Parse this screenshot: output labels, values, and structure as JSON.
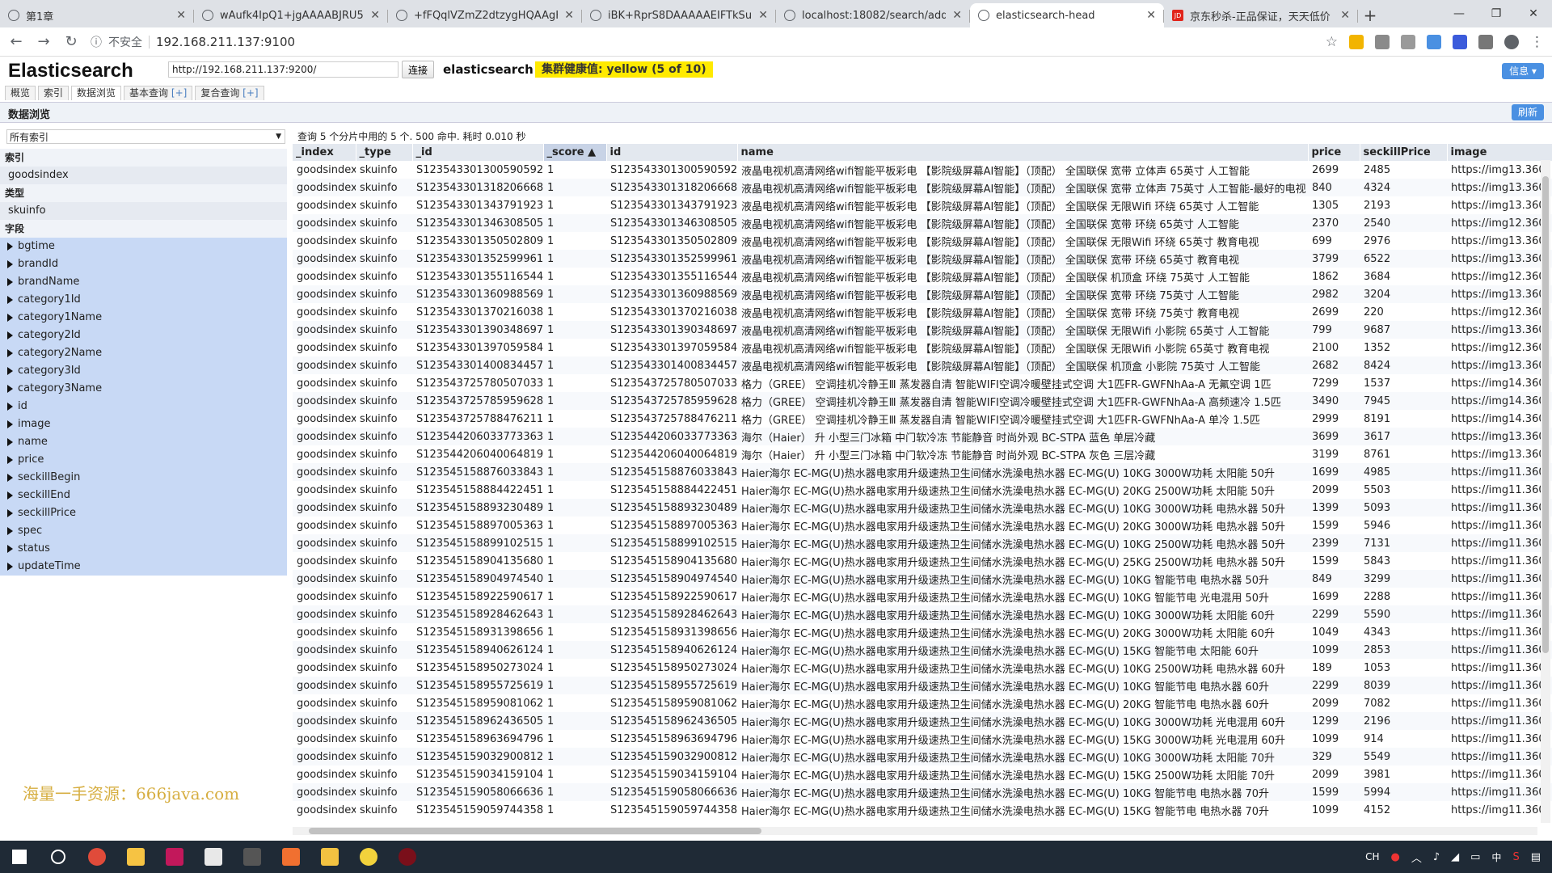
{
  "browser": {
    "tabs": [
      {
        "title": "第1章",
        "active": false
      },
      {
        "title": "wAufk4IpQ1+jgAAAABJRU5E",
        "active": false
      },
      {
        "title": "+fFQqlVZmZ2dtzygHQAAgH",
        "active": false
      },
      {
        "title": "iBK+RprS8DAAAAAEIFTkSuQm",
        "active": false
      },
      {
        "title": "localhost:18082/search/add/a",
        "active": false
      },
      {
        "title": "elasticsearch-head",
        "active": true
      },
      {
        "title": "京东秒杀-正品保证，天天低价",
        "active": false
      }
    ],
    "address_insecure": "不安全",
    "address_url": "192.168.211.137:9100",
    "jd_favicon": "JD"
  },
  "app": {
    "brand": "Elasticsearch",
    "cluster_url": "http://192.168.211.137:9200/",
    "connect_label": "连接",
    "cluster_name": "elasticsearch",
    "health": "集群健康值: yellow (5 of 10)",
    "info_label": "信息",
    "nav_tabs": [
      "概览",
      "索引",
      "数据浏览",
      "基本查询",
      "复合查询"
    ],
    "nav_plus": "[+]",
    "section_title": "数据浏览",
    "refresh_label": "刷新"
  },
  "sidebar": {
    "index_select": "所有索引",
    "index_header": "索引",
    "index_item": "goodsindex",
    "type_header": "类型",
    "type_item": "skuinfo",
    "fields_header": "字段",
    "fields": [
      "bgtime",
      "brandId",
      "brandName",
      "category1Id",
      "category1Name",
      "category2Id",
      "category2Name",
      "category3Id",
      "category3Name",
      "id",
      "image",
      "name",
      "price",
      "seckillBegin",
      "seckillEnd",
      "seckillPrice",
      "spec",
      "status",
      "updateTime"
    ]
  },
  "watermark": "海量一手资源：666java.com",
  "results": {
    "summary": "查询 5 个分片中用的 5 个. 500 命中. 耗时 0.010 秒",
    "columns": [
      "_index",
      "_type",
      "_id",
      "_score ▲",
      "id",
      "name",
      "price",
      "seckillPrice",
      "image"
    ],
    "rows": [
      [
        "goodsindex",
        "skuinfo",
        "S1235433013005905920",
        "1",
        "S1235433013005905920",
        "液晶电视机高清网络wifi智能平板彩电 【影院级屏幕AI智能】（顶配） 全国联保 宽带 立体声 65英寸 人工智能",
        "2699",
        "2485",
        "https://img13.360"
      ],
      [
        "goodsindex",
        "skuinfo",
        "S1235433013182066688",
        "1",
        "S1235433013182066688",
        "液晶电视机高清网络wifi智能平板彩电 【影院级屏幕AI智能】（顶配） 全国联保 宽带 立体声 75英寸 人工智能-最好的电视",
        "840",
        "4324",
        "https://img13.360"
      ],
      [
        "goodsindex",
        "skuinfo",
        "S1235433013437919232",
        "1",
        "S1235433013437919232",
        "液晶电视机高清网络wifi智能平板彩电 【影院级屏幕AI智能】（顶配） 全国联保 无限Wifi 环绕 65英寸 人工智能",
        "1305",
        "2193",
        "https://img13.360"
      ],
      [
        "goodsindex",
        "skuinfo",
        "S1235433013463085056",
        "1",
        "S1235433013463085056",
        "液晶电视机高清网络wifi智能平板彩电 【影院级屏幕AI智能】（顶配） 全国联保 宽带 环绕 65英寸 人工智能",
        "2370",
        "2540",
        "https://img12.360"
      ],
      [
        "goodsindex",
        "skuinfo",
        "S1235433013505028096",
        "1",
        "S1235433013505028096",
        "液晶电视机高清网络wifi智能平板彩电 【影院级屏幕AI智能】（顶配） 全国联保 无限Wifi 环绕 65英寸 教育电视",
        "699",
        "2976",
        "https://img13.360"
      ],
      [
        "goodsindex",
        "skuinfo",
        "S1235433013525999616",
        "1",
        "S1235433013525999616",
        "液晶电视机高清网络wifi智能平板彩电 【影院级屏幕AI智能】（顶配） 全国联保 宽带 环绕 65英寸 教育电视",
        "3799",
        "6522",
        "https://img13.360"
      ],
      [
        "goodsindex",
        "skuinfo",
        "S1235433013551165440",
        "1",
        "S1235433013551165440",
        "液晶电视机高清网络wifi智能平板彩电 【影院级屏幕AI智能】（顶配） 全国联保 机顶盒 环绕 75英寸 人工智能",
        "1862",
        "3684",
        "https://img12.360"
      ],
      [
        "goodsindex",
        "skuinfo",
        "S1235433013609885696",
        "1",
        "S1235433013609885696",
        "液晶电视机高清网络wifi智能平板彩电 【影院级屏幕AI智能】（顶配） 全国联保 宽带 环绕 75英寸 人工智能",
        "2982",
        "3204",
        "https://img13.360"
      ],
      [
        "goodsindex",
        "skuinfo",
        "S1235433013702160384",
        "1",
        "S1235433013702160384",
        "液晶电视机高清网络wifi智能平板彩电 【影院级屏幕AI智能】（顶配） 全国联保 宽带 环绕 75英寸 教育电视",
        "2699",
        "220",
        "https://img12.360"
      ],
      [
        "goodsindex",
        "skuinfo",
        "S1235433013903486976",
        "1",
        "S1235433013903486976",
        "液晶电视机高清网络wifi智能平板彩电 【影院级屏幕AI智能】（顶配） 全国联保 无限Wifi 小影院 65英寸 人工智能",
        "799",
        "9687",
        "https://img13.360"
      ],
      [
        "goodsindex",
        "skuinfo",
        "S1235433013970595840",
        "1",
        "S1235433013970595840",
        "液晶电视机高清网络wifi智能平板彩电 【影院级屏幕AI智能】（顶配） 全国联保 无限Wifi 小影院 65英寸 教育电视",
        "2100",
        "1352",
        "https://img12.360"
      ],
      [
        "goodsindex",
        "skuinfo",
        "S1235433014008344576",
        "1",
        "S1235433014008344576",
        "液晶电视机高清网络wifi智能平板彩电 【影院级屏幕AI智能】（顶配） 全国联保 机顶盒 小影院 75英寸 人工智能",
        "2682",
        "8424",
        "https://img13.360"
      ],
      [
        "goodsindex",
        "skuinfo",
        "S1235437257805070336",
        "1",
        "S1235437257805070336",
        "格力（GREE） 空调挂机冷静王Ⅲ 蒸发器自清 智能WIFI空调冷暖壁挂式空调 大1匹FR-GWFNhAa-A 无氟空调 1匹",
        "7299",
        "1537",
        "https://img14.360"
      ],
      [
        "goodsindex",
        "skuinfo",
        "S1235437257859596288",
        "1",
        "S1235437257859596288",
        "格力（GREE） 空调挂机冷静王Ⅲ 蒸发器自清 智能WIFI空调冷暖壁挂式空调 大1匹FR-GWFNhAa-A 高频速冷 1.5匹",
        "3490",
        "7945",
        "https://img14.360"
      ],
      [
        "goodsindex",
        "skuinfo",
        "S1235437257884762112",
        "1",
        "S1235437257884762112",
        "格力（GREE） 空调挂机冷静王Ⅲ 蒸发器自清 智能WIFI空调冷暖壁挂式空调 大1匹FR-GWFNhAa-A 单冷 1.5匹",
        "2999",
        "8191",
        "https://img14.360"
      ],
      [
        "goodsindex",
        "skuinfo",
        "S1235442060337733632",
        "1",
        "S1235442060337733632",
        "海尔（Haier） 升 小型三门冰箱 中门软冷冻 节能静音 时尚外观 BC-STPA 蓝色 单层冷藏",
        "3699",
        "3617",
        "https://img13.360"
      ],
      [
        "goodsindex",
        "skuinfo",
        "S1235442060400648192",
        "1",
        "S1235442060400648192",
        "海尔（Haier） 升 小型三门冰箱 中门软冷冻 节能静音 时尚外观 BC-STPA 灰色 三层冷藏",
        "3199",
        "8761",
        "https://img13.360"
      ],
      [
        "goodsindex",
        "skuinfo",
        "S1235451588760338432",
        "1",
        "S1235451588760338432",
        "Haier海尔 EC-MG(U)热水器电家用升级速热卫生间储水洗澡电热水器 EC-MG(U) 10KG 3000W功耗 太阳能 50升",
        "1699",
        "4985",
        "https://img11.360"
      ],
      [
        "goodsindex",
        "skuinfo",
        "S1235451588844224512",
        "1",
        "S1235451588844224512",
        "Haier海尔 EC-MG(U)热水器电家用升级速热卫生间储水洗澡电热水器 EC-MG(U) 20KG 2500W功耗 太阳能 50升",
        "2099",
        "5503",
        "https://img11.360"
      ],
      [
        "goodsindex",
        "skuinfo",
        "S1235451588932304896",
        "1",
        "S1235451588932304896",
        "Haier海尔 EC-MG(U)热水器电家用升级速热卫生间储水洗澡电热水器 EC-MG(U) 10KG 3000W功耗 电热水器 50升",
        "1399",
        "5093",
        "https://img11.360"
      ],
      [
        "goodsindex",
        "skuinfo",
        "S1235451588970053632",
        "1",
        "S1235451588970053632",
        "Haier海尔 EC-MG(U)热水器电家用升级速热卫生间储水洗澡电热水器 EC-MG(U) 20KG 3000W功耗 电热水器 50升",
        "1599",
        "5946",
        "https://img11.360"
      ],
      [
        "goodsindex",
        "skuinfo",
        "S1235451588991025152",
        "1",
        "S1235451588991025152",
        "Haier海尔 EC-MG(U)热水器电家用升级速热卫生间储水洗澡电热水器 EC-MG(U) 10KG 2500W功耗 电热水器 50升",
        "2399",
        "7131",
        "https://img11.360"
      ],
      [
        "goodsindex",
        "skuinfo",
        "S1235451589041356800",
        "1",
        "S1235451589041356800",
        "Haier海尔 EC-MG(U)热水器电家用升级速热卫生间储水洗澡电热水器 EC-MG(U) 25KG 2500W功耗 电热水器 50升",
        "1599",
        "5843",
        "https://img11.360"
      ],
      [
        "goodsindex",
        "skuinfo",
        "S1235451589049745408",
        "1",
        "S1235451589049745408",
        "Haier海尔 EC-MG(U)热水器电家用升级速热卫生间储水洗澡电热水器 EC-MG(U) 10KG 智能节电 电热水器 50升",
        "849",
        "3299",
        "https://img11.360"
      ],
      [
        "goodsindex",
        "skuinfo",
        "S1235451589225906176",
        "1",
        "S1235451589225906176",
        "Haier海尔 EC-MG(U)热水器电家用升级速热卫生间储水洗澡电热水器 EC-MG(U) 10KG 智能节电 光电混用 50升",
        "1699",
        "2288",
        "https://img11.360"
      ],
      [
        "goodsindex",
        "skuinfo",
        "S1235451589284626432",
        "1",
        "S1235451589284626432",
        "Haier海尔 EC-MG(U)热水器电家用升级速热卫生间储水洗澡电热水器 EC-MG(U) 10KG 3000W功耗 太阳能 60升",
        "2299",
        "5590",
        "https://img11.360"
      ],
      [
        "goodsindex",
        "skuinfo",
        "S1235451589313986560",
        "1",
        "S1235451589313986560",
        "Haier海尔 EC-MG(U)热水器电家用升级速热卫生间储水洗澡电热水器 EC-MG(U) 20KG 3000W功耗 太阳能 60升",
        "1049",
        "4343",
        "https://img11.360"
      ],
      [
        "goodsindex",
        "skuinfo",
        "S1235451589406261248",
        "1",
        "S1235451589406261248",
        "Haier海尔 EC-MG(U)热水器电家用升级速热卫生间储水洗澡电热水器 EC-MG(U) 15KG 智能节电 太阳能 60升",
        "1099",
        "2853",
        "https://img11.360"
      ],
      [
        "goodsindex",
        "skuinfo",
        "S1235451589502730240",
        "1",
        "S1235451589502730240",
        "Haier海尔 EC-MG(U)热水器电家用升级速热卫生间储水洗澡电热水器 EC-MG(U) 10KG 2500W功耗 电热水器 60升",
        "189",
        "1053",
        "https://img11.360"
      ],
      [
        "goodsindex",
        "skuinfo",
        "S1235451589557256192",
        "1",
        "S1235451589557256192",
        "Haier海尔 EC-MG(U)热水器电家用升级速热卫生间储水洗澡电热水器 EC-MG(U) 10KG 智能节电 电热水器 60升",
        "2299",
        "8039",
        "https://img11.360"
      ],
      [
        "goodsindex",
        "skuinfo",
        "S1235451589590810624",
        "1",
        "S1235451589590810624",
        "Haier海尔 EC-MG(U)热水器电家用升级速热卫生间储水洗澡电热水器 EC-MG(U) 20KG 智能节电 电热水器 60升",
        "2099",
        "7082",
        "https://img11.360"
      ],
      [
        "goodsindex",
        "skuinfo",
        "S1235451589624365056",
        "1",
        "S1235451589624365056",
        "Haier海尔 EC-MG(U)热水器电家用升级速热卫生间储水洗澡电热水器 EC-MG(U) 10KG 3000W功耗 光电混用 60升",
        "1299",
        "2196",
        "https://img11.360"
      ],
      [
        "goodsindex",
        "skuinfo",
        "S1235451589636947968",
        "1",
        "S1235451589636947968",
        "Haier海尔 EC-MG(U)热水器电家用升级速热卫生间储水洗澡电热水器 EC-MG(U) 15KG 3000W功耗 光电混用 60升",
        "1099",
        "914",
        "https://img11.360"
      ],
      [
        "goodsindex",
        "skuinfo",
        "S1235451590329008128",
        "1",
        "S1235451590329008128",
        "Haier海尔 EC-MG(U)热水器电家用升级速热卫生间储水洗澡电热水器 EC-MG(U) 10KG 3000W功耗 太阳能 70升",
        "329",
        "5549",
        "https://img11.360"
      ],
      [
        "goodsindex",
        "skuinfo",
        "S1235451590341591040",
        "1",
        "S1235451590341591040",
        "Haier海尔 EC-MG(U)热水器电家用升级速热卫生间储水洗澡电热水器 EC-MG(U) 15KG 2500W功耗 太阳能 70升",
        "2099",
        "3981",
        "https://img11.360"
      ],
      [
        "goodsindex",
        "skuinfo",
        "S1235451590580666368",
        "1",
        "S1235451590580666368",
        "Haier海尔 EC-MG(U)热水器电家用升级速热卫生间储水洗澡电热水器 EC-MG(U) 10KG 智能节电 电热水器 70升",
        "1599",
        "5994",
        "https://img11.360"
      ],
      [
        "goodsindex",
        "skuinfo",
        "S1235451590597443584",
        "1",
        "S1235451590597443584",
        "Haier海尔 EC-MG(U)热水器电家用升级速热卫生间储水洗澡电热水器 EC-MG(U) 15KG 智能节电 电热水器 70升",
        "1099",
        "4152",
        "https://img11.360"
      ]
    ]
  },
  "taskbar": {
    "tray_lang": "CH",
    "tray_ime": "中"
  },
  "colors": {
    "health_yellow": "#ffea00",
    "field_blue": "#c8d9f5",
    "button_blue": "#4a90e2"
  }
}
